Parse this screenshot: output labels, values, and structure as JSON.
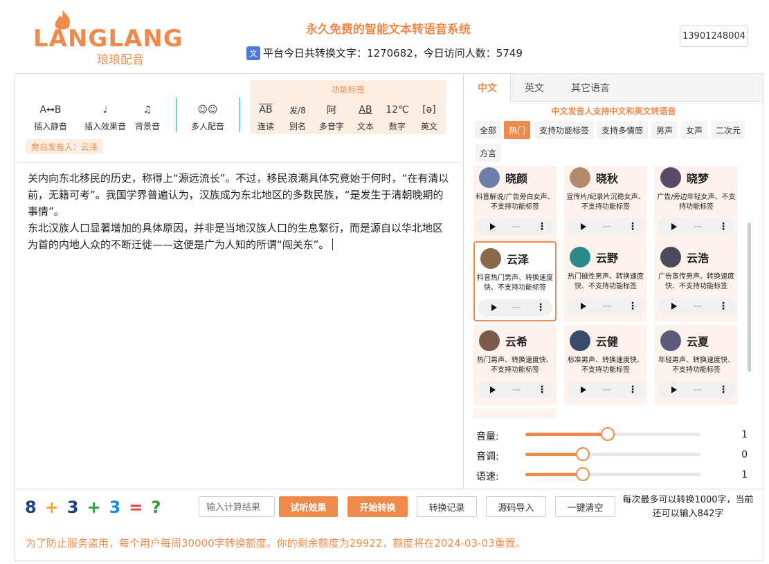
{
  "header": {
    "logo_text": "LANGLANG",
    "logo_sub": "琅琅配音",
    "site_title": "永久免费的智能文本转语音系统",
    "stats": "平台今日共转换文字：1270682，今日访问人数：5749",
    "user": "13901248004"
  },
  "toolbar": {
    "tools": [
      {
        "icon": "A↔B",
        "label": "插入静音"
      },
      {
        "icon": "♩",
        "label": "插入效果音"
      },
      {
        "icon": "♫",
        "label": "背景音"
      },
      {
        "icon": "☺☺",
        "label": "多人配音"
      }
    ],
    "func_title": "功能标签",
    "func_tools": [
      {
        "icon": "AB",
        "label": "连读"
      },
      {
        "icon": "发/8",
        "label": "别名"
      },
      {
        "icon": "阿",
        "label": "多音字"
      },
      {
        "icon": "AB",
        "label": "文本"
      },
      {
        "icon": "12℃",
        "label": "数字"
      },
      {
        "icon": "[ə]",
        "label": "英文"
      }
    ],
    "narrator": "旁白发音人：云泽"
  },
  "editor": {
    "p1": "关内向东北移民的历史，称得上“源远流长”。不过，移民浪潮具体究竟始于何时，“在有清以前，无籍可考”。我国学界普遍认为，汉族成为东北地区的多数民族，“是发生于清朝晚期的事情”。",
    "p2": "东北汉族人口显著增加的具体原因，并非是当地汉族人口的生息繁衍，而是源自以华北地区为首的内地人众的不断迁徙——这便是广为人知的所谓“闯关东”。"
  },
  "voice_panel": {
    "tabs": [
      "中文",
      "英文",
      "其它语言"
    ],
    "note": "中文发音人支持中文和英文转语音",
    "categories": [
      "全部",
      "热门",
      "支持功能标签",
      "支持多情感",
      "男声",
      "女声",
      "二次元",
      "方言"
    ],
    "voices": [
      {
        "name": "晓颜",
        "desc": "科普解说/广告旁白女声、不支持功能标签",
        "color": "#6b7fa8"
      },
      {
        "name": "晓秋",
        "desc": "宣传片/纪录片沉稳女声、不支持功能标签",
        "color": "#b58a6a"
      },
      {
        "name": "晓梦",
        "desc": "广告/旁边年轻女声、不支持功能标签",
        "color": "#5a4a6a"
      },
      {
        "name": "云泽",
        "desc": "抖音热门男声、转换速度快、不支持功能标签",
        "color": "#8a6a4a"
      },
      {
        "name": "云野",
        "desc": "热门磁性男声、转换速度快、不支持功能标签",
        "color": "#2a8a8a"
      },
      {
        "name": "云浩",
        "desc": "广告宣传男声、转换速度快、不支持功能标签",
        "color": "#4a4a5a"
      },
      {
        "name": "云希",
        "desc": "热门男声、转换速度快、不支持功能标签",
        "color": "#7a5a4a"
      },
      {
        "name": "云健",
        "desc": "标准男声、转换速度快、不支持功能标签",
        "color": "#3a4a6a"
      },
      {
        "name": "云夏",
        "desc": "年轻男声、转换速度快、不支持功能标签",
        "color": "#5a5a7a"
      }
    ]
  },
  "sliders": [
    {
      "label": "音量:",
      "value": "1",
      "fraction": 0.47
    },
    {
      "label": "音调:",
      "value": "0",
      "fraction": 0.33
    },
    {
      "label": "语速:",
      "value": "1",
      "fraction": 0.33
    }
  ],
  "bottom": {
    "captcha": [
      {
        "ch": "8",
        "color": "#1d3f8a"
      },
      {
        "ch": "+",
        "color": "#f5a623"
      },
      {
        "ch": "3",
        "color": "#1d3f8a"
      },
      {
        "ch": "+",
        "color": "#2e9e3e"
      },
      {
        "ch": "3",
        "color": "#1e88e5"
      },
      {
        "ch": "=",
        "color": "#e53935"
      },
      {
        "ch": "?",
        "color": "#2e9e3e"
      }
    ],
    "calc_placeholder": "输入计算结果",
    "btn_preview": "试听效果",
    "btn_start": "开始转换",
    "btn_history": "转换记录",
    "btn_import": "源码导入",
    "btn_clear": "一键清空",
    "limit_note": "每次最多可以转换1000字，当前还可以输入842字",
    "quota": "为了防止服务盗用，每个用户每周30000字转换额度。你的剩余额度为29922，额度将在2024-03-03重置。"
  },
  "colors": {
    "accent": "#f08a4b",
    "accent_light": "#fdeee4"
  }
}
